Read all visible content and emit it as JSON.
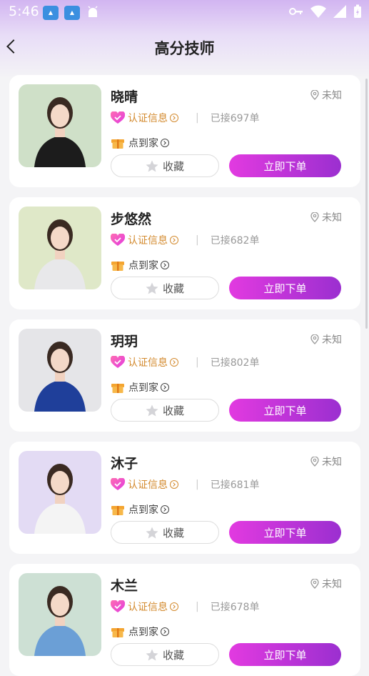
{
  "status_bar": {
    "time": "5:46",
    "icons": [
      "app-icon-1",
      "app-icon-2",
      "android-icon",
      "key-icon",
      "wifi-icon",
      "signal-icon",
      "battery-icon"
    ]
  },
  "header": {
    "back_icon": "chevron-left-icon",
    "title": "高分技师"
  },
  "technicians": [
    {
      "name": "晓晴",
      "location": "未知",
      "cert_label": "认证信息",
      "orders": "已接697单",
      "home_label": "点到家",
      "favorite_label": "收藏",
      "order_label": "立即下单",
      "photo_bg": "#cfe0c8",
      "outfit": "#1c1c1c"
    },
    {
      "name": "步悠然",
      "location": "未知",
      "cert_label": "认证信息",
      "orders": "已接682单",
      "home_label": "点到家",
      "favorite_label": "收藏",
      "order_label": "立即下单",
      "photo_bg": "#dfe8c8",
      "outfit": "#e8e8ea"
    },
    {
      "name": "玥玥",
      "location": "未知",
      "cert_label": "认证信息",
      "orders": "已接802单",
      "home_label": "点到家",
      "favorite_label": "收藏",
      "order_label": "立即下单",
      "photo_bg": "#e5e5e8",
      "outfit": "#1f3f9a"
    },
    {
      "name": "沐子",
      "location": "未知",
      "cert_label": "认证信息",
      "orders": "已接681单",
      "home_label": "点到家",
      "favorite_label": "收藏",
      "order_label": "立即下单",
      "photo_bg": "#e3dbf4",
      "outfit": "#f4f4f4"
    },
    {
      "name": "木兰",
      "location": "未知",
      "cert_label": "认证信息",
      "orders": "已接678单",
      "home_label": "点到家",
      "favorite_label": "收藏",
      "order_label": "立即下单",
      "photo_bg": "#cde0d4",
      "outfit": "#6b9fd6"
    }
  ],
  "colors": {
    "accent_start": "#e23ae0",
    "accent_end": "#9b2fd0",
    "cert": "#d38a2e",
    "gift": "#f4a531"
  }
}
